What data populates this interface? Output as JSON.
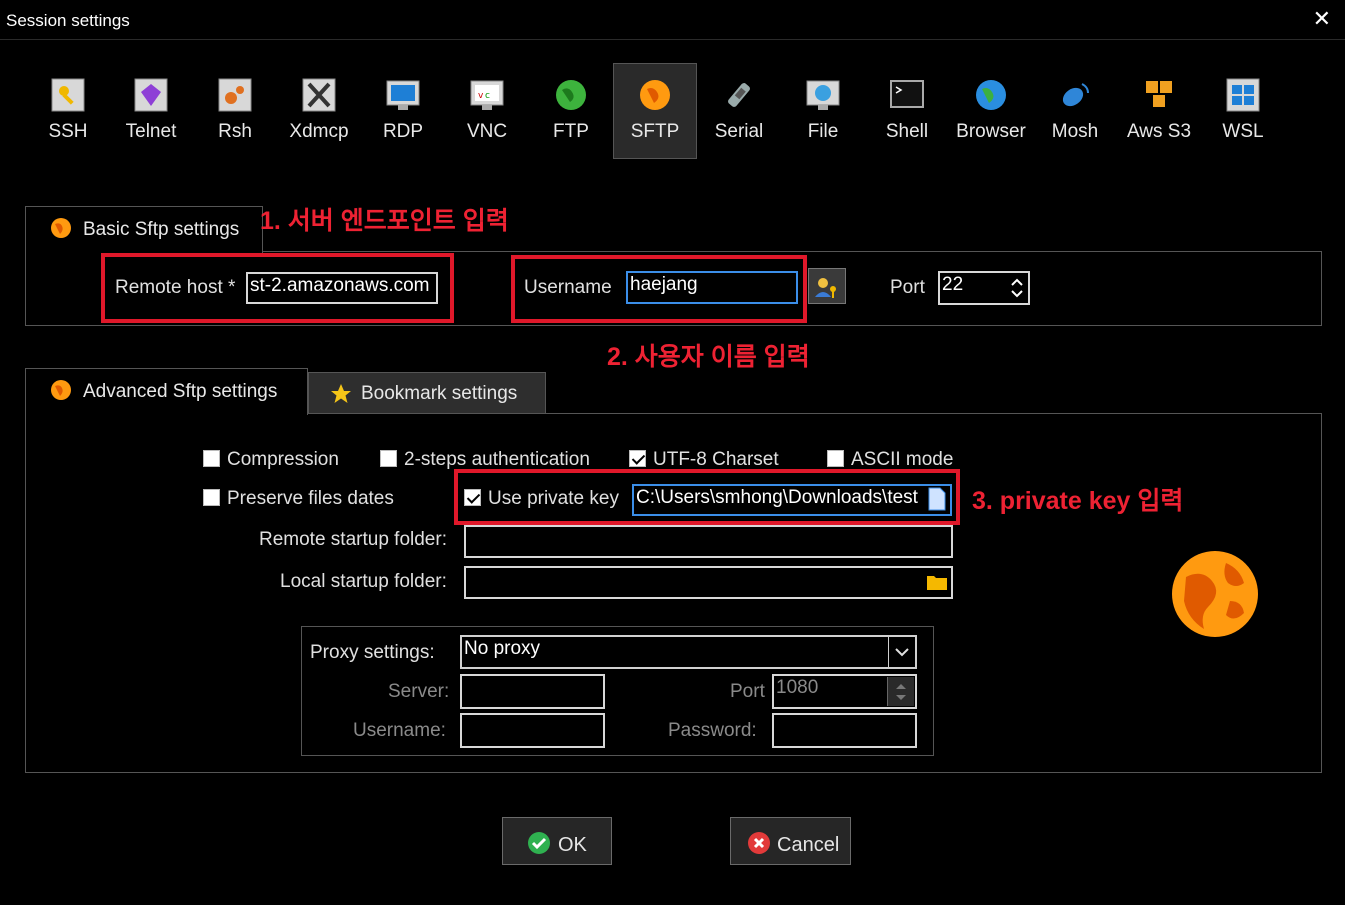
{
  "window": {
    "title": "Session settings",
    "close_glyph": "✕"
  },
  "toolbar": {
    "items": [
      {
        "label": "SSH",
        "icon": "key-icon"
      },
      {
        "label": "Telnet",
        "icon": "telnet-gem-icon"
      },
      {
        "label": "Rsh",
        "icon": "rsh-gears-icon"
      },
      {
        "label": "Xdmcp",
        "icon": "x-window-icon"
      },
      {
        "label": "RDP",
        "icon": "windows-monitor-icon"
      },
      {
        "label": "VNC",
        "icon": "vnc-monitor-icon"
      },
      {
        "label": "FTP",
        "icon": "green-globe-icon"
      },
      {
        "label": "SFTP",
        "icon": "orange-globe-icon",
        "selected": true
      },
      {
        "label": "Serial",
        "icon": "satellite-plug-icon"
      },
      {
        "label": "File",
        "icon": "globe-monitor-icon"
      },
      {
        "label": "Shell",
        "icon": "terminal-icon"
      },
      {
        "label": "Browser",
        "icon": "earth-globe-icon"
      },
      {
        "label": "Mosh",
        "icon": "satellite-dish-icon"
      },
      {
        "label": "Aws S3",
        "icon": "aws-cubes-icon"
      },
      {
        "label": "WSL",
        "icon": "windows-logo-icon"
      }
    ]
  },
  "basic": {
    "tab_label": "Basic Sftp settings",
    "remote_host_label": "Remote host *",
    "remote_host_value": "st-2.amazonaws.com",
    "username_label": "Username",
    "username_value": "haejang",
    "port_label": "Port",
    "port_value": "22"
  },
  "annotations": {
    "a1": "1. 서버 엔드포인트 입력",
    "a2": "2. 사용자 이름 입력",
    "a3": "3. private key 입력"
  },
  "advanced": {
    "tab_label": "Advanced Sftp settings",
    "bookmark_tab_label": "Bookmark settings",
    "compression": {
      "label": "Compression",
      "checked": false
    },
    "two_step": {
      "label": "2-steps authentication",
      "checked": false
    },
    "utf8": {
      "label": "UTF-8 Charset",
      "checked": true
    },
    "ascii": {
      "label": "ASCII mode",
      "checked": false
    },
    "preserve_dates": {
      "label": "Preserve files dates",
      "checked": false
    },
    "use_private_key": {
      "label": "Use private key",
      "checked": true
    },
    "private_key_value": "C:\\Users\\smhong\\Downloads\\test",
    "remote_folder_label": "Remote startup folder:",
    "remote_folder_value": "",
    "local_folder_label": "Local startup folder:",
    "local_folder_value": ""
  },
  "proxy": {
    "settings_label": "Proxy settings:",
    "selected": "No proxy",
    "server_label": "Server:",
    "server_value": "",
    "port_label": "Port",
    "port_value": "1080",
    "username_label": "Username:",
    "username_value": "",
    "password_label": "Password:",
    "password_value": ""
  },
  "buttons": {
    "ok": "OK",
    "cancel": "Cancel"
  },
  "colors": {
    "annotation": "#e0182a",
    "focus": "#3b8ee8",
    "selected_tab": "#2a2a2a"
  }
}
